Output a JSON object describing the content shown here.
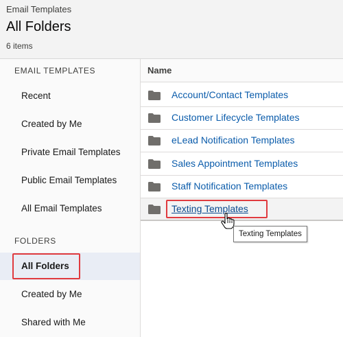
{
  "header": {
    "object_label": "Email Templates",
    "title": "All Folders",
    "item_count": "6 items"
  },
  "sidebar": {
    "email_templates_heading": "EMAIL TEMPLATES",
    "email_items": [
      {
        "label": "Recent"
      },
      {
        "label": "Created by Me"
      },
      {
        "label": "Private Email Templates"
      },
      {
        "label": "Public Email Templates"
      },
      {
        "label": "All Email Templates"
      }
    ],
    "folders_heading": "FOLDERS",
    "folder_items": [
      {
        "label": "All Folders",
        "active": true
      },
      {
        "label": "Created by Me"
      },
      {
        "label": "Shared with Me"
      }
    ]
  },
  "table": {
    "column_header": "Name",
    "rows": [
      {
        "name": "Account/Contact Templates",
        "icon": "folder-icon"
      },
      {
        "name": "Customer Lifecycle Templates",
        "icon": "folder-icon"
      },
      {
        "name": "eLead Notification Templates",
        "icon": "folder-icon"
      },
      {
        "name": "Sales Appointment Templates",
        "icon": "folder-icon"
      },
      {
        "name": "Staff Notification Templates",
        "icon": "folder-icon"
      },
      {
        "name": "Texting Templates",
        "icon": "folder-icon",
        "hovered": true
      }
    ]
  },
  "tooltip": {
    "text": "Texting Templates"
  },
  "colors": {
    "link": "#0b5cab",
    "highlight": "#e03a3e",
    "active_bg": "#e9edf5"
  }
}
